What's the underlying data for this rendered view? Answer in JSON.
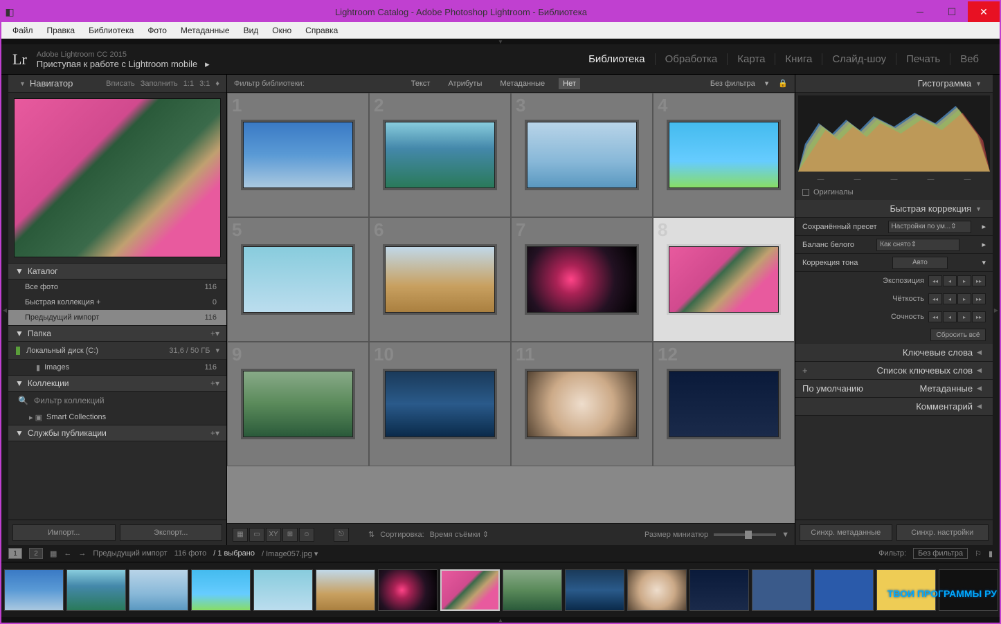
{
  "window": {
    "title": "Lightroom Catalog - Adobe Photoshop Lightroom - Библиотека"
  },
  "menubar": [
    "Файл",
    "Правка",
    "Библиотека",
    "Фото",
    "Метаданные",
    "Вид",
    "Окно",
    "Справка"
  ],
  "header": {
    "brand": "Lr",
    "product": "Adobe Lightroom CC 2015",
    "mobile": "Приступая к работе с Lightroom mobile"
  },
  "modules": [
    "Библиотека",
    "Обработка",
    "Карта",
    "Книга",
    "Слайд-шоу",
    "Печать",
    "Веб"
  ],
  "active_module": 0,
  "navigator": {
    "title": "Навигатор",
    "opts": [
      "Вписать",
      "Заполнить",
      "1:1",
      "3:1"
    ]
  },
  "catalog": {
    "title": "Каталог",
    "rows": [
      {
        "label": "Все фото",
        "count": "116",
        "sel": false
      },
      {
        "label": "Быстрая коллекция  +",
        "count": "0",
        "sel": false
      },
      {
        "label": "Предыдущий импорт",
        "count": "116",
        "sel": true
      }
    ]
  },
  "folders": {
    "title": "Папка",
    "drive": "Локальный диск (C:)",
    "usage": "31,6 / 50 ГБ",
    "child": {
      "label": "Images",
      "count": "116"
    }
  },
  "collections": {
    "title": "Коллекции",
    "filter": "Фильтр коллекций",
    "smart": "Smart Collections"
  },
  "publish": {
    "title": "Службы публикации"
  },
  "buttons": {
    "import": "Импорт...",
    "export": "Экспорт..."
  },
  "filterbar": {
    "label": "Фильтр библиотеки:",
    "opts": [
      "Текст",
      "Атрибуты",
      "Метаданные",
      "Нет"
    ],
    "active": 3,
    "preset": "Без фильтра"
  },
  "toolbar": {
    "sort_label": "Сортировка:",
    "sort_value": "Время съёмки",
    "thumb_label": "Размер миниатюр"
  },
  "right": {
    "histogram": "Гистограмма",
    "originals": "Оригиналы",
    "quick": {
      "title": "Быстрая коррекция",
      "preset_lbl": "Сохранённый пресет",
      "preset_val": "Настройки по ум...",
      "wb_lbl": "Баланс белого",
      "wb_val": "Как снято",
      "tone_lbl": "Коррекция тона",
      "auto": "Авто",
      "exposure": "Экспозиция",
      "clarity": "Чёткость",
      "vibrance": "Сочность",
      "reset": "Сбросить всё"
    },
    "keywords": "Ключевые слова",
    "keyword_list": "Список ключевых слов",
    "metadata": "Метаданные",
    "metadata_preset": "По умолчанию",
    "comment": "Комментарий",
    "sync_meta": "Синхр. метаданные",
    "sync_settings": "Синхр. настройки"
  },
  "status": {
    "crumb": "Предыдущий импорт",
    "count": "116 фото",
    "selected": "1 выбрано",
    "file": "Image057.jpg",
    "filter_lbl": "Фильтр:",
    "filter_val": "Без фильтра"
  },
  "watermark": "ТВОИ ПРОГРАММЫ РУ"
}
